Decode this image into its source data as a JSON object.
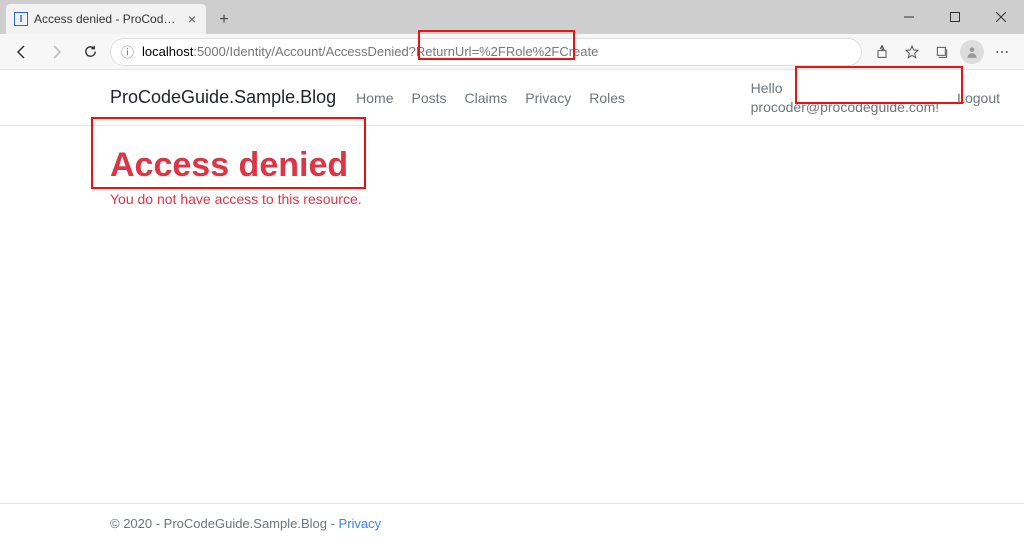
{
  "browser": {
    "tab_title": "Access denied - ProCodeGuide.S",
    "url_host": "localhost",
    "url_path": ":5000/Identity/Account/AccessDenied?ReturnUrl=%2FRole%2FCreate"
  },
  "site": {
    "brand": "ProCodeGuide.Sample.Blog",
    "nav": {
      "home": "Home",
      "posts": "Posts",
      "claims": "Claims",
      "privacy": "Privacy",
      "roles": "Roles"
    },
    "user": {
      "greeting_line1": "Hello",
      "greeting_line2": "procoder@procodeguide.com!",
      "logout": "Logout"
    }
  },
  "page": {
    "title": "Access denied",
    "message": "You do not have access to this resource."
  },
  "footer": {
    "copyright": "© 2020 - ProCodeGuide.Sample.Blog - ",
    "privacy_link": "Privacy"
  }
}
